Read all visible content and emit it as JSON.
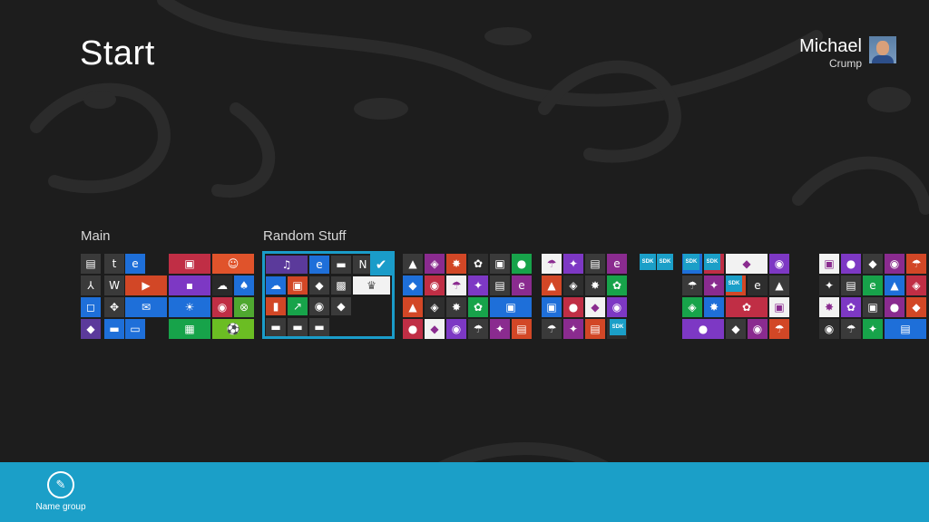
{
  "screen": {
    "title": "Start"
  },
  "user": {
    "first_name": "Michael",
    "last_name": "Crump"
  },
  "groups": [
    {
      "name": "Main"
    },
    {
      "name": "Random Stuff"
    }
  ],
  "tiles": [
    {
      "name": "tile-photos",
      "color": "#3a3a3a",
      "icon": "image-icon",
      "glyph": "▤"
    },
    {
      "name": "tile-twitter",
      "color": "#3a3a3a",
      "icon": "twitter-icon",
      "glyph": "t"
    },
    {
      "name": "tile-internet-explorer",
      "color": "#1e6fd9",
      "icon": "ie-icon",
      "glyph": "e"
    },
    {
      "name": "tile-acrobat",
      "color": "#3a3a3a",
      "icon": "acrobat-icon",
      "glyph": "⅄"
    },
    {
      "name": "tile-word",
      "color": "#3a3a3a",
      "icon": "word-icon",
      "glyph": "W"
    },
    {
      "name": "tile-video",
      "color": "#d24726",
      "icon": "video-icon",
      "glyph": "▶"
    },
    {
      "name": "tile-store",
      "color": "#1e6fd9",
      "icon": "store-icon",
      "glyph": "◻"
    },
    {
      "name": "tile-games",
      "color": "#3a3a3a",
      "icon": "gamepad-icon",
      "glyph": "✥"
    },
    {
      "name": "tile-mail",
      "color": "#1e6fd9",
      "icon": "mail-icon",
      "glyph": "✉"
    },
    {
      "name": "tile-app-purple",
      "color": "#5b3a9b",
      "icon": "app-icon",
      "glyph": "◆"
    },
    {
      "name": "tile-app-blue",
      "color": "#1e6fd9",
      "icon": "app-icon",
      "glyph": "▬"
    },
    {
      "name": "tile-desktop",
      "color": "#1e6fd9",
      "icon": "desktop-icon",
      "glyph": "▭"
    },
    {
      "name": "tile-people-card",
      "color": "#c02e45",
      "icon": "contact-card-icon",
      "glyph": "▣"
    },
    {
      "name": "tile-people",
      "color": "#e0532b",
      "icon": "people-icon",
      "glyph": "☺"
    },
    {
      "name": "tile-messaging",
      "color": "#7d38c4",
      "icon": "messaging-icon",
      "glyph": "▪"
    },
    {
      "name": "tile-app-dark",
      "color": "#2a2a2a",
      "icon": "app-icon",
      "glyph": "☁"
    },
    {
      "name": "tile-solitaire",
      "color": "#1e6fd9",
      "icon": "cards-icon",
      "glyph": "♠"
    },
    {
      "name": "tile-weather",
      "color": "#1e6fd9",
      "icon": "sun-icon",
      "glyph": "☀"
    },
    {
      "name": "tile-camera",
      "color": "#c02e45",
      "icon": "camera-icon",
      "glyph": "◉"
    },
    {
      "name": "tile-xbox",
      "color": "#4fa830",
      "icon": "xbox-icon",
      "glyph": "⊗"
    },
    {
      "name": "tile-calculator",
      "color": "#17a34a",
      "icon": "calculator-icon",
      "glyph": "▦"
    },
    {
      "name": "tile-sports",
      "color": "#6bbd23",
      "icon": "soccer-ball-icon",
      "glyph": "⚽"
    },
    {
      "name": "tile-music",
      "color": "#5b3a9b",
      "icon": "headphones-icon",
      "glyph": "♫"
    },
    {
      "name": "tile-ie-2",
      "color": "#1e6fd9",
      "icon": "ie-icon",
      "glyph": "e"
    },
    {
      "name": "tile-cmd",
      "color": "#3a3a3a",
      "icon": "terminal-icon",
      "glyph": "▬"
    },
    {
      "name": "tile-app-yellow",
      "color": "#3a3a3a",
      "icon": "app-icon",
      "glyph": "N"
    },
    {
      "name": "tile-skydrive",
      "color": "#1e6fd9",
      "icon": "cloud-icon",
      "glyph": "☁"
    },
    {
      "name": "tile-remote",
      "color": "#d24726",
      "icon": "remote-icon",
      "glyph": "▣"
    },
    {
      "name": "tile-app-green",
      "color": "#3a3a3a",
      "icon": "app-icon",
      "glyph": "◆"
    },
    {
      "name": "tile-app-gray",
      "color": "#3a3a3a",
      "icon": "app-icon",
      "glyph": "▩"
    },
    {
      "name": "tile-chess",
      "color": "#f2f2f2",
      "icon": "chess-icon",
      "glyph": "♛"
    },
    {
      "name": "tile-office",
      "color": "#d24726",
      "icon": "office-icon",
      "glyph": "▮"
    },
    {
      "name": "tile-finance",
      "color": "#17a34a",
      "icon": "chart-icon",
      "glyph": "↗"
    },
    {
      "name": "tile-firefox",
      "color": "#3a3a3a",
      "icon": "firefox-icon",
      "glyph": "◉"
    },
    {
      "name": "tile-app-diamond",
      "color": "#3a3a3a",
      "icon": "app-icon",
      "glyph": "◆"
    },
    {
      "name": "tile-folder-1",
      "color": "#3a3a3a",
      "icon": "folder-icon",
      "glyph": "▬"
    },
    {
      "name": "tile-folder-2",
      "color": "#3a3a3a",
      "icon": "folder-icon",
      "glyph": "▬"
    },
    {
      "name": "tile-folder-3",
      "color": "#3a3a3a",
      "icon": "folder-icon",
      "glyph": "▬"
    }
  ],
  "sdk_label": "SDK",
  "appbar": {
    "name_group_label": "Name group"
  }
}
